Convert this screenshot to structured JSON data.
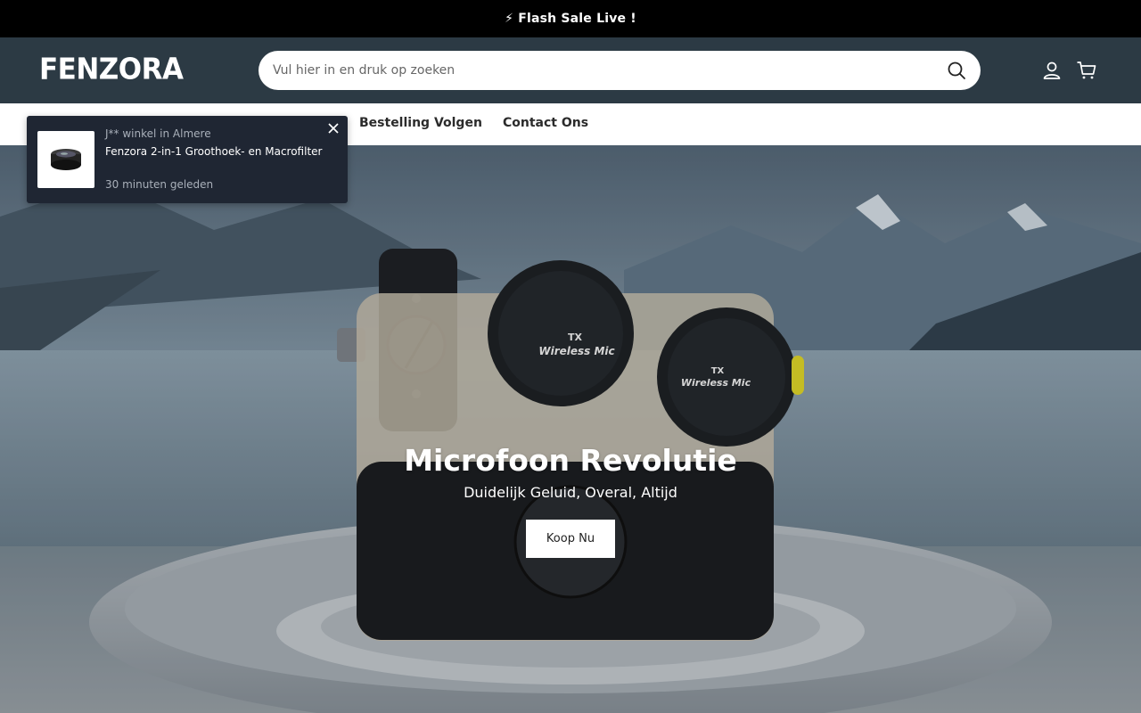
{
  "announcement": {
    "icon": "lightning-icon",
    "text": "⚡ Flash Sale Live !"
  },
  "header": {
    "logo": "FENZORA",
    "search": {
      "placeholder": "Vul hier in en druk op zoeken",
      "value": ""
    }
  },
  "nav": {
    "items": [
      "Bestelling Volgen",
      "Contact Ons"
    ]
  },
  "popup": {
    "meta": "J** winkel in Almere",
    "product": "Fenzora 2-in-1 Groothoek- en Macrofilter",
    "time": "30 minuten geleden"
  },
  "hero": {
    "title": "Microfoon Revolutie",
    "subtitle": "Duidelijk Geluid, Overal, Altijd",
    "button": "Koop Nu",
    "product_labels": [
      "TX",
      "Wireless Mic",
      "TX",
      "Wireless Mic"
    ]
  },
  "colors": {
    "header_bg": "#2c3a44",
    "announcement_bg": "#000000",
    "popup_bg": "#1f2633"
  }
}
